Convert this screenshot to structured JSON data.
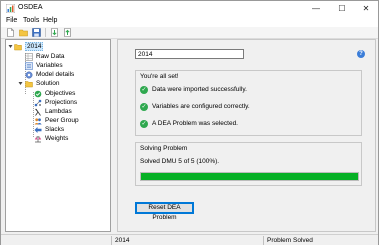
{
  "window": {
    "title": "OSDEA",
    "minimize_glyph": "—",
    "maximize_glyph": "☐",
    "close_glyph": "✕"
  },
  "menu": {
    "file": "File",
    "tools": "Tools",
    "help": "Help"
  },
  "toolbar": {
    "icons": [
      "new-file-icon",
      "open-folder-icon",
      "save-icon",
      "import-icon",
      "export-icon"
    ]
  },
  "tree": {
    "root": "2014",
    "items": [
      "Raw Data",
      "Variables",
      "Model details",
      "Solution"
    ],
    "solution_children": [
      "Objectives",
      "Projections",
      "Lambdas",
      "Peer Group",
      "Slacks",
      "Weights"
    ]
  },
  "main": {
    "problem_name": "2014",
    "status_title": "You're all set!",
    "checks": [
      "Data were imported successfully.",
      "Variables are configured correctly.",
      "A DEA Problem was selected."
    ],
    "solving_title": "Solving Problem",
    "solving_text": "Solved DMU 5 of 5 (100%).",
    "progress_fraction": 1.0,
    "reset_label": "Reset DEA Problem",
    "help_glyph": "?"
  },
  "statusbar": {
    "cell1": "",
    "problem": "2014",
    "status": "Problem Solved"
  },
  "colors": {
    "progress": "#06b025",
    "check": "#2fa84f",
    "selection": "#cce8ff",
    "focus_border": "#0078d7"
  }
}
